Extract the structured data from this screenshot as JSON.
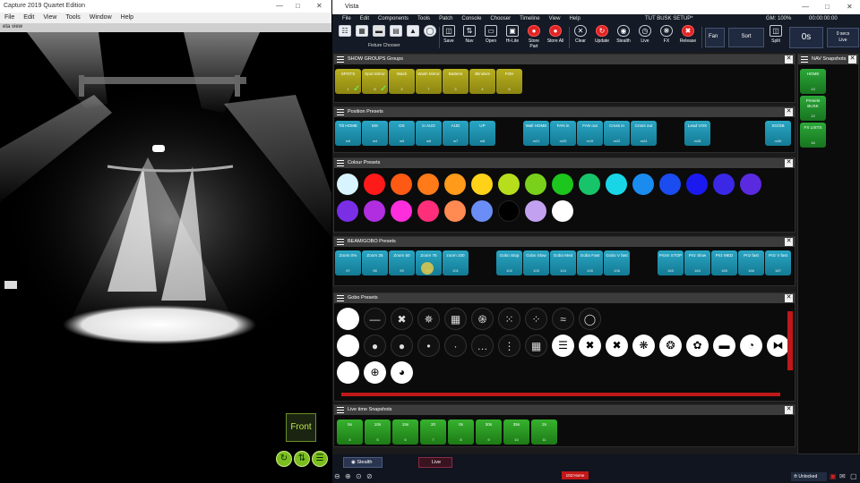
{
  "capture": {
    "title": "Capture 2019 Quartet Edition",
    "menu": [
      "File",
      "Edit",
      "View",
      "Tools",
      "Window",
      "Help"
    ],
    "view_title": "eta view",
    "front_label": "Front"
  },
  "vista": {
    "title": "Vista",
    "menu": [
      "File",
      "Edit",
      "Components",
      "Tools",
      "Patch",
      "Console",
      "Chooser",
      "Timeline",
      "View",
      "Help"
    ],
    "show_name": "TUT BUSK SETUP*",
    "gm": "GM: 100%",
    "clock": "00:00:00:00",
    "fixture_chooser": "Fixture Chooser",
    "toolbar": [
      {
        "label": "Save",
        "icon": "save-icon"
      },
      {
        "label": "Nav",
        "icon": "sliders-icon"
      },
      {
        "label": "Open",
        "icon": "folder-icon"
      },
      {
        "label": "Hi-Lite",
        "icon": "highlight-icon"
      },
      {
        "label": "Store Part",
        "icon": "record-icon"
      },
      {
        "label": "Store All",
        "icon": "record-icon"
      },
      {
        "label": "Clear",
        "icon": "clear-icon"
      },
      {
        "label": "Update",
        "icon": "update-icon"
      },
      {
        "label": "Stealth",
        "icon": "eye-icon"
      },
      {
        "label": "Live",
        "icon": "clock-icon"
      },
      {
        "label": "FX",
        "icon": "fx-icon"
      },
      {
        "label": "Release",
        "icon": "release-icon"
      }
    ],
    "fan": "Fan",
    "sort": "Sort",
    "split": "Split",
    "time": "0s",
    "secs": "0 secs",
    "live": "Live"
  },
  "show_groups": {
    "title": "SHOW GROUPS Groups",
    "items": [
      {
        "label": "SPOTS",
        "num": "1"
      },
      {
        "label": "Spot Mirror",
        "num": "8"
      },
      {
        "label": "Wash",
        "num": "2"
      },
      {
        "label": "Wash Mirror",
        "num": "7"
      },
      {
        "label": "Battens",
        "num": "3"
      },
      {
        "label": "Blinders",
        "num": "4"
      },
      {
        "label": "FOH",
        "num": "5"
      }
    ]
  },
  "position_presets": {
    "title": "Position Presets",
    "items": [
      {
        "label": "Tilt HOME",
        "num": "m3"
      },
      {
        "label": "MS",
        "num": "m4"
      },
      {
        "label": "DS",
        "num": "m5"
      },
      {
        "label": "in AUD",
        "num": "m6"
      },
      {
        "label": "AUD",
        "num": "m7"
      },
      {
        "label": "UP",
        "num": "m8"
      },
      {
        "label": "Wall HOME",
        "num": "m21"
      },
      {
        "label": "FAN in",
        "num": "m20"
      },
      {
        "label": "FAN out",
        "num": "m19"
      },
      {
        "label": "Cross in",
        "num": "m22"
      },
      {
        "label": "Cross out",
        "num": "m24"
      },
      {
        "label": "Lead VOX",
        "num": "m28"
      },
      {
        "label": "SG/SB",
        "num": "m30"
      }
    ]
  },
  "colour_presets": {
    "title": "Colour Presets",
    "colors": [
      "#d8f4ff",
      "#ff1a1a",
      "#ff5a14",
      "#ff7a18",
      "#ff9a1a",
      "#ffd21a",
      "#b7de1c",
      "#79d11c",
      "#1cc61c",
      "#17c46a",
      "#18d6e6",
      "#1a8cf0",
      "#1a4cf0",
      "#1a1af0",
      "#3a28e6",
      "#5a2ae0",
      "#7a2ee6",
      "#b02ee0",
      "#ff2edc",
      "#ff2e7a",
      "#ff8a52",
      "#6a8ef5",
      "#000000",
      "#c2a2f0",
      "#ffffff"
    ]
  },
  "beam_presets": {
    "title": "BEAM/GOBO Presets",
    "items": [
      {
        "label": "Zoom 0%",
        "num": "97"
      },
      {
        "label": "Zoom 25",
        "num": "98"
      },
      {
        "label": "Zoom 50",
        "num": "99"
      },
      {
        "label": "Zoom 75",
        "num": "100"
      },
      {
        "label": "zoom 100",
        "num": "101"
      },
      {
        "label": "Gobo Stop",
        "num": "102"
      },
      {
        "label": "Gobo Slow",
        "num": "103"
      },
      {
        "label": "Gobo Med",
        "num": "104"
      },
      {
        "label": "Gobo Fast",
        "num": "105"
      },
      {
        "label": "Gobo V fast",
        "num": "106"
      },
      {
        "label": "Prizm STOP",
        "num": "163"
      },
      {
        "label": "Priz Slow",
        "num": "164"
      },
      {
        "label": "Priz MED",
        "num": "165"
      },
      {
        "label": "Priz fast",
        "num": "166"
      },
      {
        "label": "Priz V fast",
        "num": "167"
      }
    ]
  },
  "gobo_presets": {
    "title": "Gobo Presets",
    "rows": [
      [
        "open-white",
        "line",
        "cross",
        "ring-dots",
        "grid",
        "swirl",
        "dots",
        "speckle",
        "waves",
        "circle-outline"
      ],
      [
        "open-white",
        "open-large",
        "open-medium",
        "open-small",
        "open-tiny",
        "dots-row",
        "dots-column",
        "square-grid",
        "bars",
        "cross-white",
        "cross-white",
        "dot-ring",
        "dot-ring-2",
        "flower",
        "bar",
        "quarter",
        "bowtie"
      ],
      [
        "open-white",
        "wheel",
        "pie"
      ]
    ]
  },
  "live_snapshots": {
    "title": "Live time Snapshots",
    "items": [
      {
        "label": "5s",
        "num": "4"
      },
      {
        "label": "10s",
        "num": "5"
      },
      {
        "label": "15s",
        "num": "6"
      },
      {
        "label": "20",
        "num": "7"
      },
      {
        "label": "0s",
        "num": "8"
      },
      {
        "label": "30s",
        "num": "9"
      },
      {
        "label": "35s",
        "num": "10"
      },
      {
        "label": "2s",
        "num": "11"
      }
    ]
  },
  "nav_snapshots": {
    "title": "NAV Snapshots",
    "items": [
      {
        "label": "HOME",
        "num": "13"
      },
      {
        "label": "Presets BUSK",
        "num": "12"
      },
      {
        "label": "FX LISTS",
        "num": "16"
      }
    ]
  },
  "bottom": {
    "stealth": "Stealth",
    "live": "Live",
    "cue": "102:Home",
    "unlocked": "Unlocked"
  }
}
